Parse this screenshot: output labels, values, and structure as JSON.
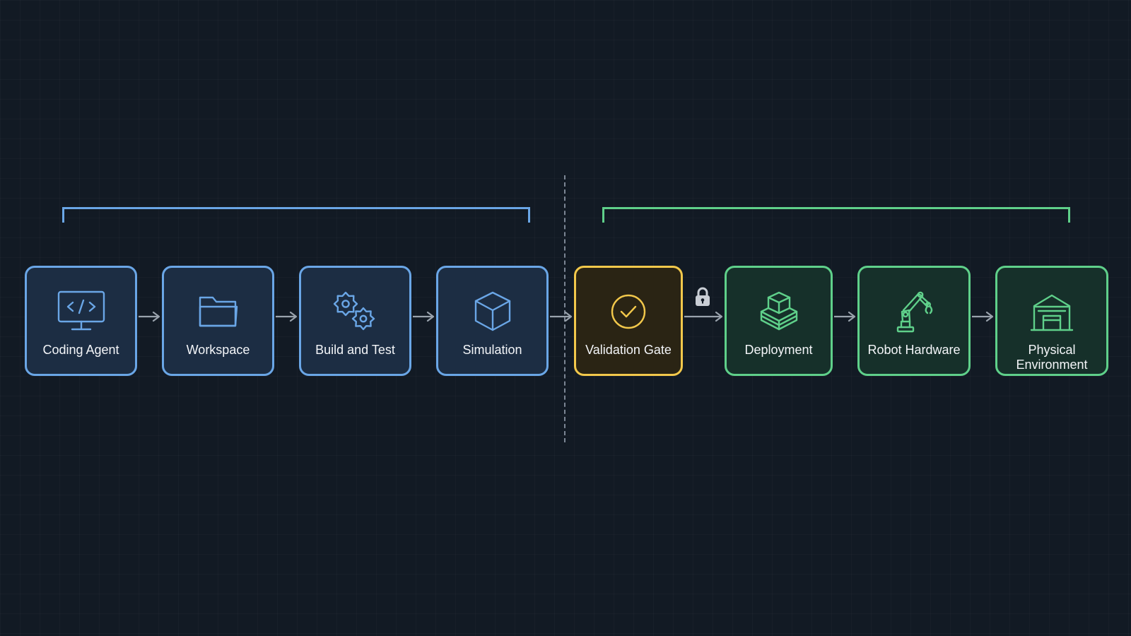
{
  "colors": {
    "background": "#121a24",
    "blue_border": "#6aa6e6",
    "blue_fill": "#1c2d43",
    "yellow_border": "#f2c84b",
    "yellow_fill": "#2a2414",
    "green_border": "#5fd08a",
    "green_fill": "#16302a",
    "arrow": "#9aa3ad",
    "divider": "#7c8694",
    "lock": "#c9ced5"
  },
  "pipeline": {
    "nodes": [
      {
        "label": "Coding Agent",
        "icon": "code-monitor-icon",
        "zone": "blue"
      },
      {
        "label": "Workspace",
        "icon": "folder-icon",
        "zone": "blue"
      },
      {
        "label": "Build and Test",
        "icon": "gears-icon",
        "zone": "blue"
      },
      {
        "label": "Simulation",
        "icon": "cube-icon",
        "zone": "blue"
      },
      {
        "label": "Validation Gate",
        "icon": "check-circle-icon",
        "zone": "yellow"
      },
      {
        "label": "Deployment",
        "icon": "stacked-boxes-icon",
        "zone": "green"
      },
      {
        "label": "Robot Hardware",
        "icon": "robot-arm-icon",
        "zone": "green"
      },
      {
        "label": "Physical\nEnvironment",
        "icon": "warehouse-icon",
        "zone": "green"
      }
    ],
    "gate_icon": "lock-icon"
  }
}
